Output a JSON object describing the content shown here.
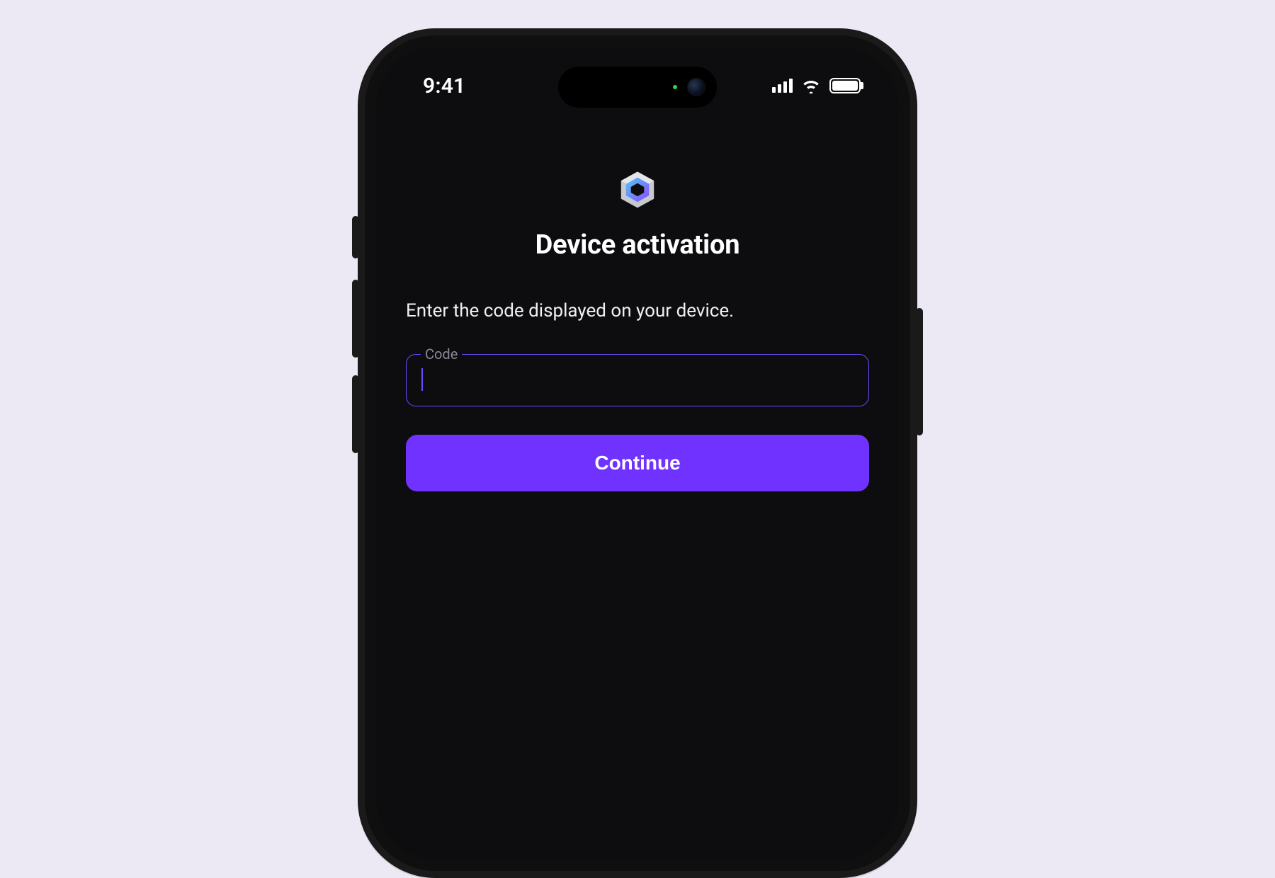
{
  "status": {
    "time": "9:41"
  },
  "icons": {
    "logo": "hexagon-logo-icon",
    "cellular": "cellular-icon",
    "wifi": "wifi-icon",
    "battery": "battery-icon"
  },
  "page": {
    "title": "Device activation",
    "instruction": "Enter the code displayed on your device."
  },
  "form": {
    "code_label": "Code",
    "code_value": "",
    "continue_label": "Continue"
  },
  "colors": {
    "accent": "#7033FF",
    "field_border": "#6D4AFF",
    "background": "#0D0D10",
    "page_background": "#ECE9F5"
  }
}
